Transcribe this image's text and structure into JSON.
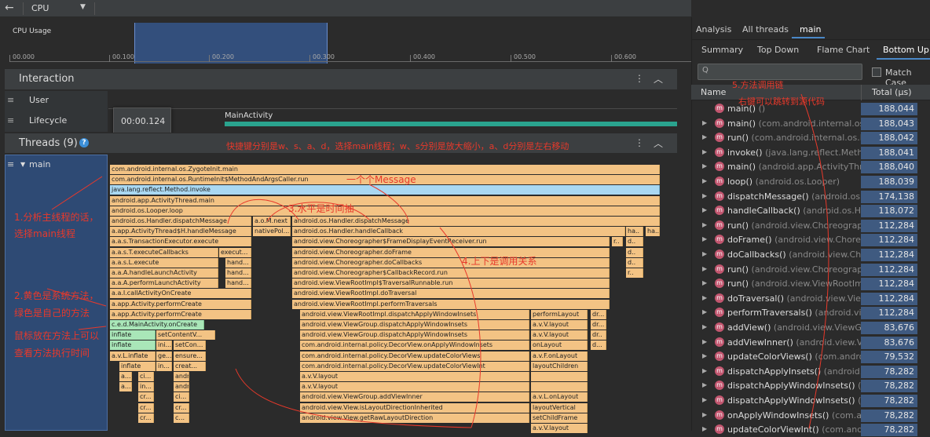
{
  "toolbar": {
    "back": "←",
    "dropdown": "CPU",
    "dropdown_arrow": "▼"
  },
  "cpu": {
    "label": "CPU Usage",
    "ticks": [
      "00.000",
      "00.100",
      "00.200",
      "00.300",
      "00.400",
      "00.500",
      "00.600"
    ]
  },
  "interaction": {
    "title": "Interaction",
    "kebab": "⋮",
    "collapse": "︿",
    "rows": [
      {
        "label": "User"
      },
      {
        "label": "Lifecycle"
      }
    ],
    "tooltip": "00:00.124",
    "activity": "MainActivity"
  },
  "threads": {
    "title": "Threads (9)",
    "help": "?",
    "kebab": "⋮",
    "collapse": "︿",
    "thread": "main",
    "expand": "▼",
    "menu": "≡"
  },
  "flame": [
    [
      "com.android.internal.os.ZygoteInit.main"
    ],
    [
      "com.android.internal.os.RuntimeInit$MethodAndArgsCaller.run"
    ],
    [
      "java.lang.reflect.Method.invoke"
    ],
    [
      "android.app.ActivityThread.main"
    ],
    [
      "android.os.Looper.loop"
    ],
    [
      "android.os.Handler.dispatchMessage",
      "a.o.M.next",
      "android.os.Handler.dispatchMessage"
    ],
    [
      "a.app.ActivityThread$H.handleMessage",
      "nativePol...",
      "android.os.Handler.handleCallback",
      "ha..",
      "ha.."
    ],
    [
      "a.a.s.TransactionExecutor.execute",
      "android.view.Choreographer$FrameDisplayEventReceiver.run",
      "r..",
      "d.."
    ],
    [
      "a.a.s.T.executeCallbacks",
      "execut...",
      "android.view.Choreographer.doFrame",
      "d.."
    ],
    [
      "a.a.s.L.execute",
      "hand...",
      "android.view.Choreographer.doCallbacks",
      "d.."
    ],
    [
      "a.a.A.handleLaunchActivity",
      "hand...",
      "android.view.Choreographer$CallbackRecord.run",
      "r.."
    ],
    [
      "a.a.A.performLaunchActivity",
      "hand...",
      "android.view.ViewRootImpl$TraversalRunnable.run"
    ],
    [
      "a.a.I.callActivityOnCreate",
      "android.view.ViewRootImpl.doTraversal"
    ],
    [
      "a.app.Activity.performCreate",
      "android.view.ViewRootImpl.performTraversals"
    ],
    [
      "a.app.Activity.performCreate",
      "android.view.ViewRootImpl.dispatchApplyWindowInsets",
      "performLayout",
      "dr..."
    ],
    [
      "c.e.d.MainActivity.onCreate",
      "android.view.ViewGroup.dispatchApplyWindowInsets",
      "a.v.V.layout",
      "dr..."
    ],
    [
      "inflate",
      "setContentV...",
      "android.view.ViewGroup.dispatchApplyWindowInsets",
      "a.v.V.layout",
      "dr.."
    ],
    [
      "inflate",
      "ini...",
      "setCon...",
      "com.android.internal.policy.DecorView.onApplyWindowInsets",
      "onLayout",
      "d..."
    ],
    [
      "a.v.L.inflate",
      "ge...",
      "ensure...",
      "com.android.internal.policy.DecorView.updateColorViews",
      "a.v.F.onLayout"
    ],
    [
      "inflate",
      "in...",
      "creat...",
      "com.android.internal.policy.DecorView.updateColorViewInt",
      "layoutChildren"
    ],
    [
      "a...",
      "ci...",
      "android.view.ViewGroup.addView",
      "a.v.V.layout"
    ],
    [
      "a...",
      "in...",
      "android.view.ViewGroup.addView",
      "a.v.V.layout"
    ],
    [
      "cr...",
      "ci...",
      "android.view.ViewGroup.addViewInner",
      "a.v.L.onLayout"
    ],
    [
      "cr...",
      "cr...",
      "android.view.View.isLayoutDirectionInherited",
      "layoutVertical"
    ],
    [
      "cr...",
      "c...",
      "android.view.View.getRawLayoutDirection",
      "setChildFrame"
    ],
    [
      "a.v.V.layout"
    ]
  ],
  "annotations": {
    "a1": "快捷键分别是w、s、a、d，选择main线程；w、s分别是放大缩小，a、d分别是左右移动",
    "a2": "一个个Message",
    "a3": "3.水平是时间抽",
    "a4": "4.上下是调用关系",
    "a5a": "1.分析主线程的话，",
    "a5b": "选择main线程",
    "a6a": "2.黄色是系统方法，",
    "a6b": "绿色是自己的方法",
    "a7a": "鼠标放在方法上可以",
    "a7b": "查看方法执行时间",
    "a8": "5.方法调用链",
    "a9": "右键可以跳转到源代码"
  },
  "right": {
    "tabs1": [
      "Analysis",
      "All threads",
      "main"
    ],
    "tabs2": [
      "Summary",
      "Top Down",
      "Flame Chart",
      "Bottom Up"
    ],
    "search_icon": "Q",
    "match_case": "Match Case",
    "col_name": "Name",
    "col_total": "Total (μs)",
    "rows": [
      {
        "name": "main()",
        "pkg": " ()",
        "total": "188,044",
        "arrow": ""
      },
      {
        "name": "main()",
        "pkg": " (com.android.internal.os.Z",
        "total": "188,043",
        "arrow": "▶"
      },
      {
        "name": "run()",
        "pkg": " (com.android.internal.os.Ru",
        "total": "188,042",
        "arrow": "▶"
      },
      {
        "name": "invoke()",
        "pkg": " (java.lang.reflect.Method",
        "total": "188,041",
        "arrow": "▶"
      },
      {
        "name": "main()",
        "pkg": " (android.app.ActivityThrea",
        "total": "188,040",
        "arrow": "▶"
      },
      {
        "name": "loop()",
        "pkg": " (android.os.Looper)",
        "total": "188,039",
        "arrow": "▶"
      },
      {
        "name": "dispatchMessage()",
        "pkg": " (android.os.H",
        "total": "174,138",
        "arrow": "▶"
      },
      {
        "name": "handleCallback()",
        "pkg": " (android.os.Han",
        "total": "118,072",
        "arrow": "▶"
      },
      {
        "name": "run()",
        "pkg": " (android.view.Choreographe",
        "total": "112,284",
        "arrow": "▶"
      },
      {
        "name": "doFrame()",
        "pkg": " (android.view.Choreo",
        "total": "112,284",
        "arrow": "▶"
      },
      {
        "name": "doCallbacks()",
        "pkg": " (android.view.Chor",
        "total": "112,284",
        "arrow": "▶"
      },
      {
        "name": "run()",
        "pkg": " (android.view.Choreographe",
        "total": "112,284",
        "arrow": "▶"
      },
      {
        "name": "run()",
        "pkg": " (android.view.ViewRootImpl",
        "total": "112,284",
        "arrow": "▶"
      },
      {
        "name": "doTraversal()",
        "pkg": " (android.view.ViewI",
        "total": "112,284",
        "arrow": "▶"
      },
      {
        "name": "performTraversals()",
        "pkg": " (android.vi",
        "total": "112,284",
        "arrow": "▶"
      },
      {
        "name": "addView()",
        "pkg": " (android.view.ViewGro",
        "total": "83,676",
        "arrow": "▶"
      },
      {
        "name": "addViewInner()",
        "pkg": " (android.view.Vie",
        "total": "83,676",
        "arrow": "▶"
      },
      {
        "name": "updateColorViews()",
        "pkg": " (com.android",
        "total": "79,532",
        "arrow": "▶"
      },
      {
        "name": "dispatchApplyInsets()",
        "pkg": " (android.vi",
        "total": "78,282",
        "arrow": "▶"
      },
      {
        "name": "dispatchApplyWindowInsets()",
        "pkg": " (andr",
        "total": "78,282",
        "arrow": "▶"
      },
      {
        "name": "dispatchApplyWindowInsets()",
        "pkg": " (andr",
        "total": "78,282",
        "arrow": "▶"
      },
      {
        "name": "onApplyWindowInsets()",
        "pkg": " (com.and",
        "total": "78,282",
        "arrow": "▶"
      },
      {
        "name": "updateColorViewInt()",
        "pkg": " (com.andro",
        "total": "78,282",
        "arrow": "▶"
      }
    ]
  }
}
